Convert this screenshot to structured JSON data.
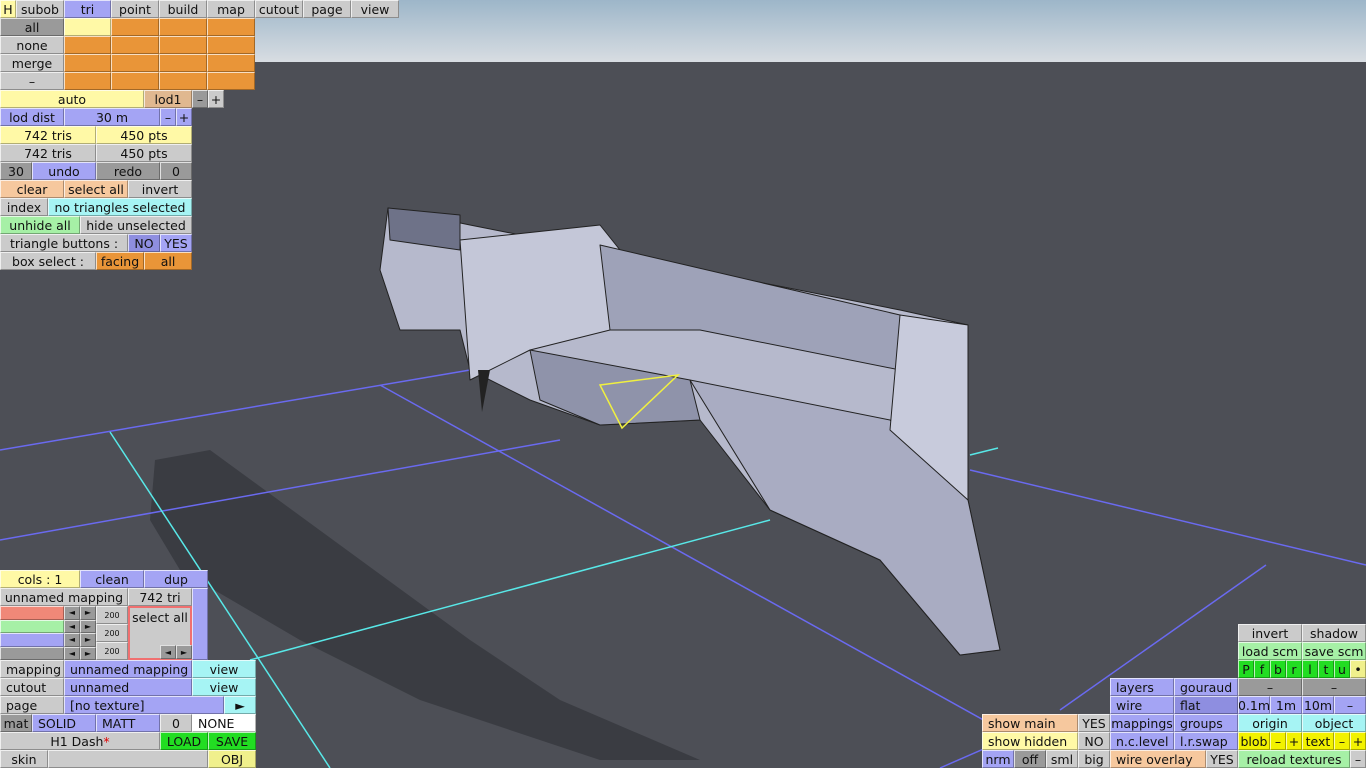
{
  "top_tabs": {
    "h": "H",
    "subob": "subob",
    "tri": "tri",
    "point": "point",
    "build": "build",
    "map": "map",
    "cutout": "cutout",
    "page": "page",
    "view": "view"
  },
  "selection": {
    "all": "all",
    "none": "none",
    "merge": "merge",
    "dash": "–"
  },
  "lod": {
    "auto": "auto",
    "lod": "lod1",
    "minus": "–",
    "plus": "+",
    "dist_label": "lod dist",
    "dist_value": "30 m"
  },
  "counts": {
    "tris_a": "742 tris",
    "pts_a": "450 pts",
    "tris_b": "742 tris",
    "pts_b": "450 pts"
  },
  "history": {
    "undo_count": "30",
    "undo": "undo",
    "redo": "redo",
    "redo_count": "0"
  },
  "actions": {
    "clear": "clear",
    "select_all": "select all",
    "invert": "invert",
    "index": "index",
    "status": "no triangles selected",
    "unhide_all": "unhide all",
    "hide_unselected": "hide unselected",
    "triangle_buttons": "triangle buttons :",
    "no": "NO",
    "yes": "YES",
    "box_select": "box select :",
    "facing": "facing",
    "all": "all"
  },
  "mapping_panel": {
    "cols": "cols : 1",
    "clean": "clean",
    "dup": "dup",
    "mapping_name": "unnamed mapping",
    "tri_count": "742 tri",
    "slider_values": [
      "200",
      "200",
      "200"
    ],
    "slider_colors": [
      "#f08878",
      "#a6f0a6",
      "#a4a4f4",
      "#9a9a9a"
    ],
    "select_all": "select all",
    "arrow_left": "◄",
    "arrow_right": "►"
  },
  "properties": {
    "mapping_label": "mapping",
    "mapping_value": "unnamed mapping",
    "view": "view",
    "cutout_label": "cutout",
    "cutout_value": "unnamed",
    "page_label": "page",
    "page_value": "[no texture]",
    "page_arrow": "►",
    "mat": "mat",
    "solid": "SOLID",
    "matt": "MATT",
    "mat_num": "0",
    "none": "NONE",
    "file_name": "H1 Dash",
    "modified_mark": "*",
    "load": "LOAD",
    "save": "SAVE",
    "skin": "skin",
    "skin_value": "",
    "obj": "OBJ"
  },
  "view_panel": {
    "invert": "invert",
    "shadow": "shadow",
    "load_scm": "load scm",
    "save_scm": "save scm",
    "views": [
      "P",
      "f",
      "b",
      "r",
      "l",
      "t",
      "u",
      "•"
    ],
    "dash": "–",
    "layers": "layers",
    "gouraud": "gouraud",
    "wire": "wire",
    "flat": "flat",
    "g01": "0.1m",
    "g1": "1m",
    "g10": "10m",
    "origin": "origin",
    "object": "object",
    "mappings": "mappings",
    "groups": "groups",
    "ncl": "n.c.level",
    "lrswap": "l.r.swap",
    "blob": "blob",
    "text": "text",
    "plus": "+",
    "show_main": "show main",
    "show_main_val": "YES",
    "show_hidden": "show hidden",
    "show_hidden_val": "NO",
    "nrm": "nrm",
    "off": "off",
    "sml": "sml",
    "big": "big",
    "wire_overlay": "wire overlay",
    "wire_overlay_val": "YES",
    "reload": "reload textures"
  },
  "colors": {
    "sky_top": "#c9d7e2",
    "ground": "#4d4f56",
    "grid": "#6a6af0",
    "axis": "#58e8e8",
    "model": "#b8bbd0",
    "selected_edge": "#f0f040"
  }
}
